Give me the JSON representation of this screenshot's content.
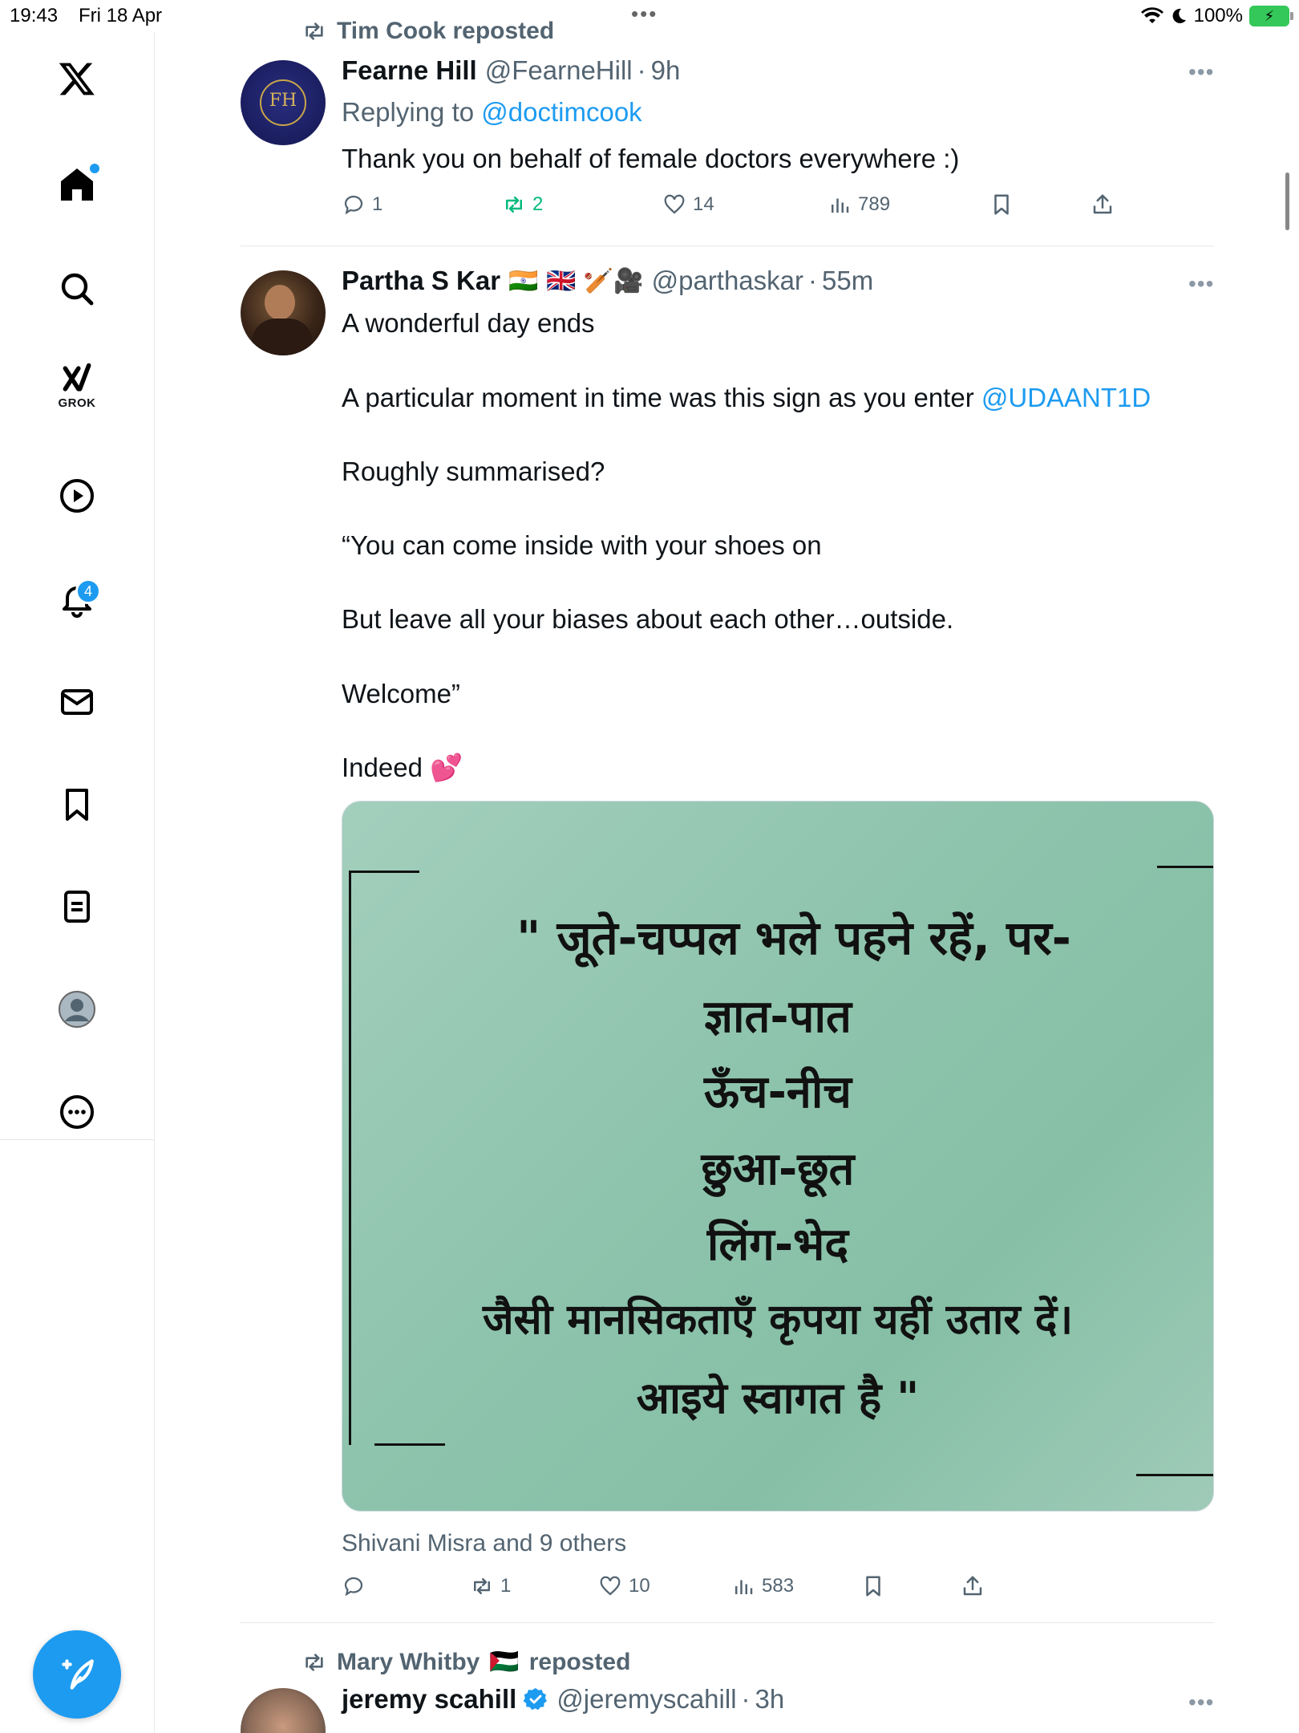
{
  "status_bar": {
    "time": "19:43",
    "date": "Fri 18 Apr",
    "battery": "100%"
  },
  "sidebar": {
    "grok_label": "GROK",
    "notifications_badge": "4",
    "items": [
      "x-logo",
      "home",
      "search",
      "grok",
      "video",
      "notifications",
      "messages",
      "bookmarks",
      "lists",
      "profile",
      "more"
    ]
  },
  "tweet1": {
    "repost_by": "Tim Cook reposted",
    "name": "Fearne Hill",
    "handle": "@FearneHill",
    "sep": "·",
    "time": "9h",
    "replying_prefix": "Replying to",
    "replying_to": "@doctimcook",
    "text": "Thank you on behalf of female doctors everywhere :)",
    "replies": "1",
    "reposts": "2",
    "likes": "14",
    "views": "789",
    "avatar_initials": "FH"
  },
  "tweet2": {
    "name": "Partha S Kar",
    "name_emojis": "🇮🇳 🇬🇧 🏏🎥",
    "handle": "@parthaskar",
    "sep": "·",
    "time": "55m",
    "line1": "A wonderful day ends",
    "line2_prefix": "A particular moment in time was this sign as you enter",
    "line2_link": "@UDAANT1D",
    "line3": "Roughly summarised?",
    "line4": "“You can come inside with your shoes on",
    "line5": "But leave all your biases about each other…outside.",
    "line6": "Welcome”",
    "line7": "Indeed 💕",
    "sign_lines": [
      "\" जूते-चप्पल भले पहने रहें, पर-",
      "ज्ञात-पात",
      "ऊँच-नीच",
      "छुआ-छूत",
      "लिंग-भेद",
      "जैसी मानसिकताएँ कृपया यहीं उतार दें।",
      "आइये स्वागत है \""
    ],
    "liked_by": "Shivani Misra and 9 others",
    "reposts": "1",
    "likes": "10",
    "views": "583"
  },
  "tweet3": {
    "repost_by_name": "Mary Whitby",
    "repost_flag": "🇵🇸",
    "repost_suffix": "reposted",
    "name": "jeremy scahill",
    "handle": "@jeremyscahill",
    "sep": "·",
    "time": "3h"
  },
  "colors": {
    "accent": "#1d9bf0",
    "repost_green": "#00ba7c",
    "muted": "#536471"
  }
}
